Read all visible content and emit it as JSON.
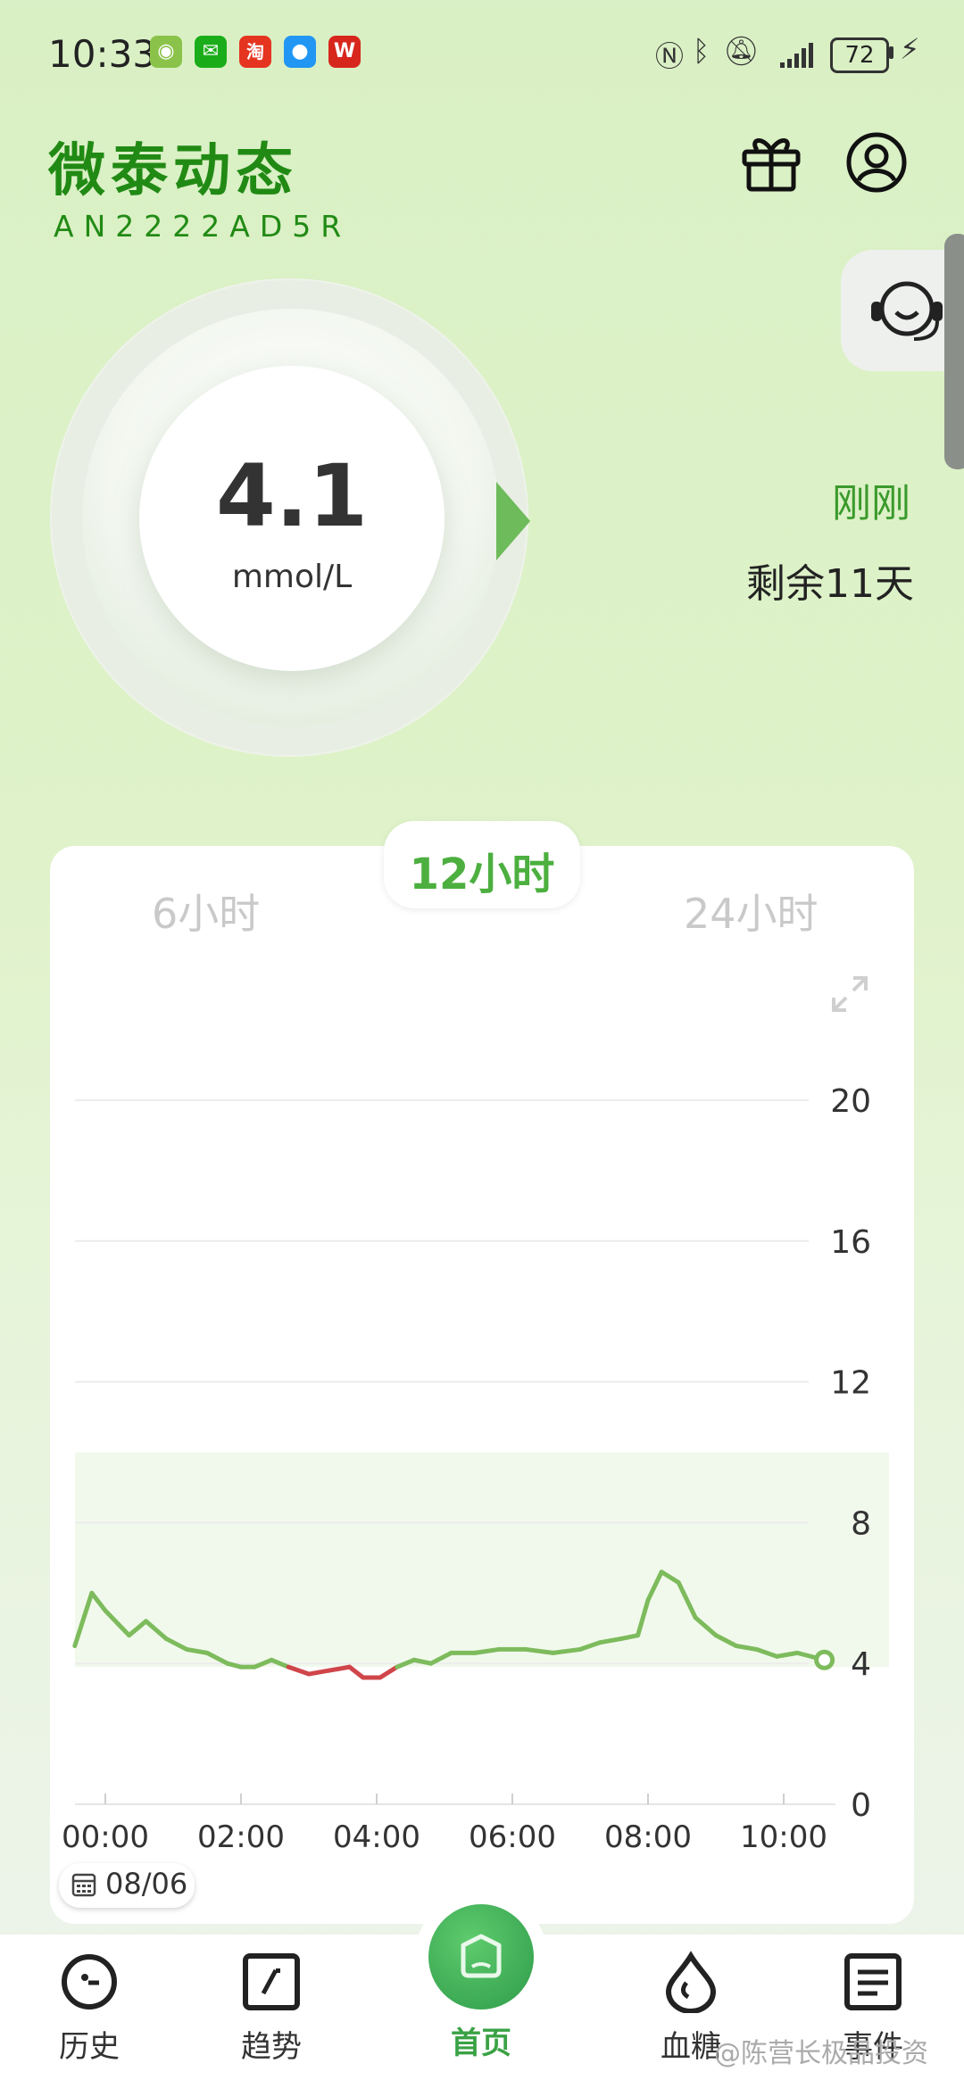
{
  "status_bar": {
    "time": "10:33",
    "battery": "72",
    "apps": [
      "wechat-green-app",
      "wechat",
      "taobao",
      "messages",
      "wps"
    ],
    "icons": [
      "nfc-icon",
      "bluetooth-icon",
      "mute-bell-icon",
      "signal-icon",
      "charging-icon"
    ]
  },
  "header": {
    "title": "微泰动态",
    "serial": "AN2222AD5R"
  },
  "gauge": {
    "value": "4.1",
    "unit": "mmol/L",
    "last_update": "刚刚",
    "remaining": "剩余11天",
    "trend_color": "#6dbb5a"
  },
  "chart_tabs": {
    "left": "6小时",
    "active": "12小时",
    "right": "24小时"
  },
  "chart_data": {
    "type": "line",
    "x_labels": [
      "00:00",
      "02:00",
      "04:00",
      "06:00",
      "08:00",
      "10:00"
    ],
    "y_ticks": [
      "20",
      "16",
      "12",
      "8",
      "4",
      "0"
    ],
    "ylim": [
      0,
      20
    ],
    "target_range": [
      3.9,
      10.0
    ],
    "low_threshold": 3.9,
    "x_range_hours": [
      -0.45,
      10.95
    ],
    "series": [
      {
        "points": [
          [
            -0.45,
            4.5
          ],
          [
            -0.2,
            6.0
          ],
          [
            0.0,
            5.5
          ],
          [
            0.35,
            4.8
          ],
          [
            0.6,
            5.2
          ],
          [
            0.9,
            4.7
          ],
          [
            1.2,
            4.4
          ],
          [
            1.5,
            4.3
          ],
          [
            1.8,
            4.0
          ],
          [
            2.0,
            3.9
          ],
          [
            2.2,
            3.9
          ],
          [
            2.45,
            4.1
          ],
          [
            2.7,
            3.9
          ],
          [
            3.0,
            3.7
          ],
          [
            3.3,
            3.8
          ],
          [
            3.6,
            3.9
          ],
          [
            3.8,
            3.6
          ],
          [
            4.05,
            3.6
          ],
          [
            4.3,
            3.9
          ],
          [
            4.55,
            4.1
          ],
          [
            4.8,
            4.0
          ],
          [
            5.1,
            4.3
          ],
          [
            5.45,
            4.3
          ],
          [
            5.8,
            4.4
          ],
          [
            6.2,
            4.4
          ],
          [
            6.6,
            4.3
          ],
          [
            7.0,
            4.4
          ],
          [
            7.3,
            4.6
          ],
          [
            7.6,
            4.7
          ],
          [
            7.85,
            4.8
          ],
          [
            8.0,
            5.8
          ],
          [
            8.2,
            6.6
          ],
          [
            8.45,
            6.3
          ],
          [
            8.7,
            5.3
          ],
          [
            9.0,
            4.8
          ],
          [
            9.3,
            4.5
          ],
          [
            9.6,
            4.4
          ],
          [
            9.9,
            4.2
          ],
          [
            10.2,
            4.3
          ],
          [
            10.6,
            4.1
          ]
        ],
        "color": "#7dbb5c",
        "low_color": "#d0454a"
      }
    ],
    "date": "08/06",
    "grid": true
  },
  "nav": {
    "history": "历史",
    "trend": "趋势",
    "home": "首页",
    "glucose": "血糖",
    "events": "事件"
  },
  "watermark": "@陈营长极品投资"
}
